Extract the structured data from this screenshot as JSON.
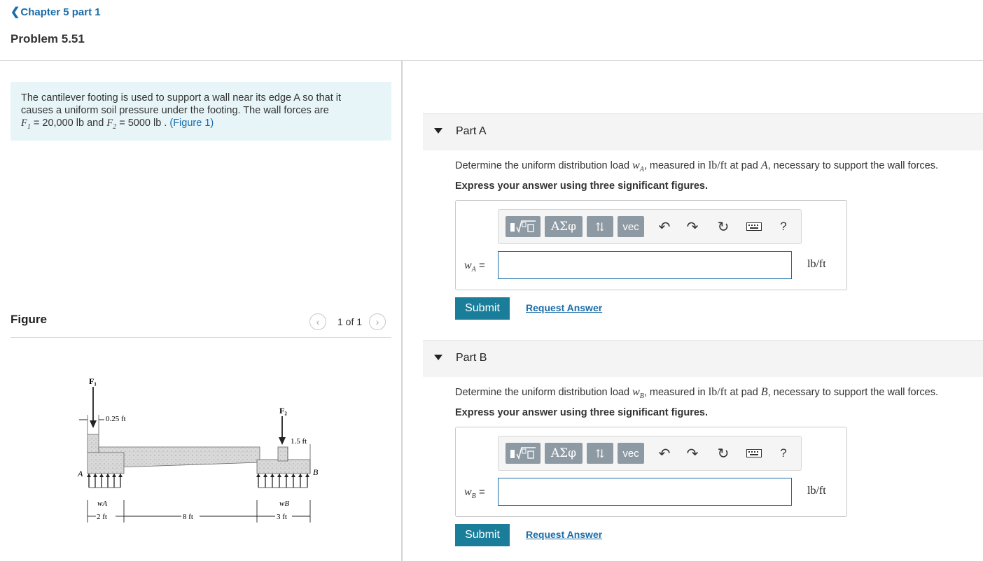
{
  "nav": {
    "back_label": "Chapter 5 part 1"
  },
  "problem": {
    "title": "Problem 5.51",
    "text_line1": "The cantilever footing is used to support a wall near its edge A so that it",
    "text_line2": "causes a uniform soil pressure under the footing. The wall forces are",
    "f1_value": "= 20,000 lb and",
    "f2_value": "= 5000  lb .",
    "figure_link": "(Figure 1)"
  },
  "figure": {
    "label": "Figure",
    "pager": "1 of 1",
    "labels": {
      "f1": "F₁",
      "f2": "F₂",
      "dim_025": "0.25 ft",
      "dim_15": "1.5 ft",
      "pt_a": "A",
      "pt_b": "B",
      "wa": "wA",
      "wb": "wB",
      "dim_2": "2 ft",
      "dim_8": "8 ft",
      "dim_3": "3 ft"
    }
  },
  "parts": [
    {
      "title": "Part A",
      "question_pre": "Determine the uniform distribution load",
      "var": "wA",
      "question_mid": ", measured in",
      "unit_inline": "lb/ft",
      "question_post": "at pad",
      "pad": "A",
      "question_end": ", necessary to support the wall forces.",
      "instruction": "Express your answer using three significant figures.",
      "answer_label": "wA =",
      "answer_unit": "lb/ft",
      "answer_value": "",
      "submit": "Submit",
      "request": "Request Answer"
    },
    {
      "title": "Part B",
      "question_pre": "Determine the uniform distribution load",
      "var": "wB",
      "question_mid": ", measured in",
      "unit_inline": "lb/ft",
      "question_post": "at pad",
      "pad": "B",
      "question_end": ", necessary to support the wall forces.",
      "instruction": "Express your answer using three significant figures.",
      "answer_label": "wB =",
      "answer_unit": "lb/ft",
      "answer_value": "",
      "submit": "Submit",
      "request": "Request Answer"
    }
  ],
  "toolbar": {
    "greek": "ΑΣφ",
    "arrows": "⇅",
    "vec": "vec",
    "help": "?"
  }
}
